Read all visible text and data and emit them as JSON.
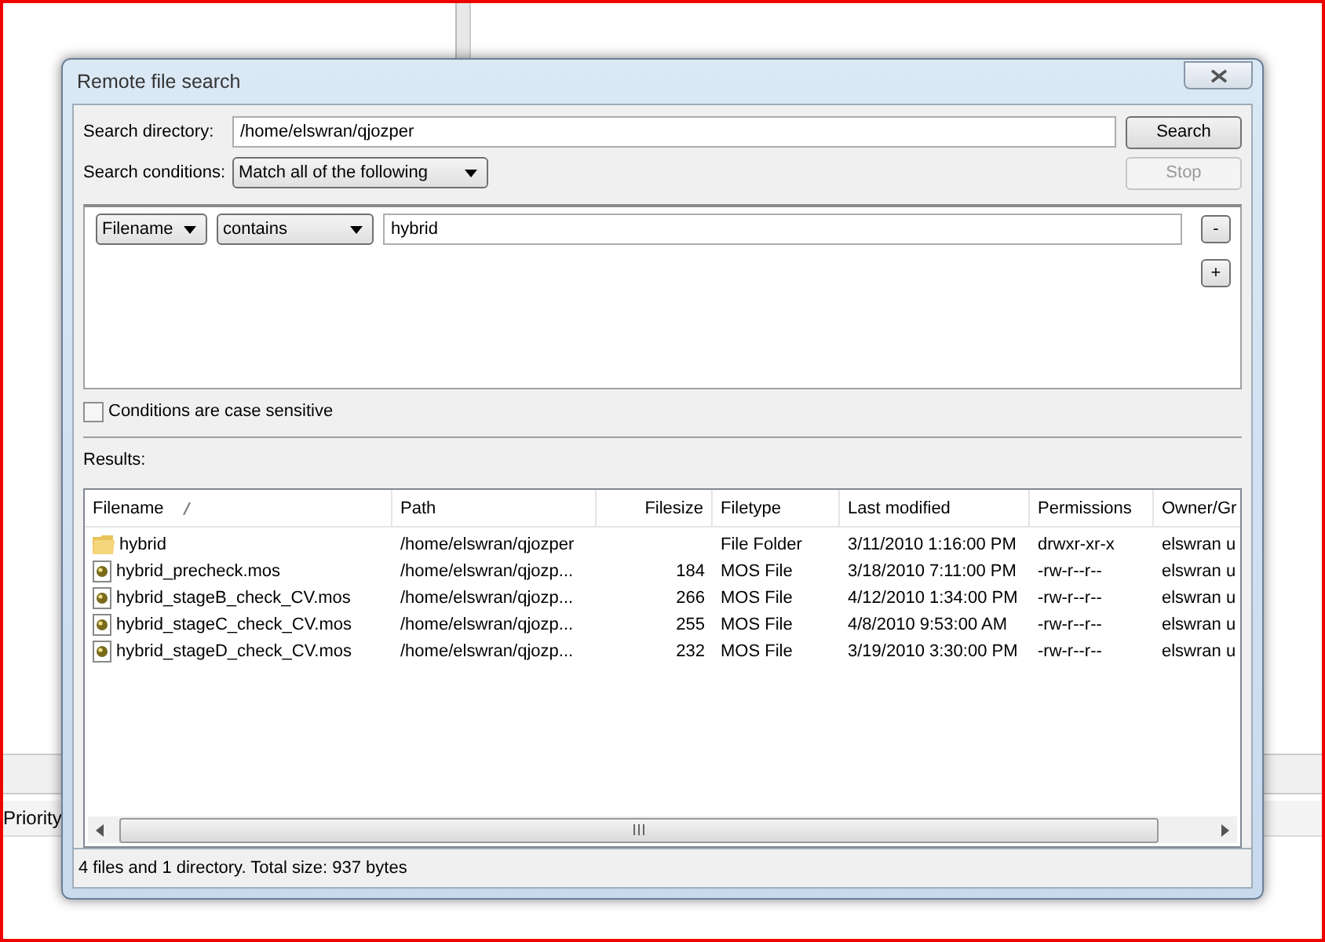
{
  "background": {
    "column_label": "Priority"
  },
  "window": {
    "title": "Remote file search"
  },
  "search_directory": {
    "label": "Search directory:",
    "value": "/home/elswran/qjozper"
  },
  "search_button": {
    "label": "Search",
    "disabled": false
  },
  "search_conditions": {
    "label": "Search conditions:",
    "value": "Match all of the following"
  },
  "stop_button": {
    "label": "Stop",
    "disabled": true
  },
  "conditions": [
    {
      "field": "Filename",
      "operator": "contains",
      "value": "hybrid",
      "remove_label": "-"
    }
  ],
  "add_button": {
    "label": "+"
  },
  "case_sensitive": {
    "label": "Conditions are case sensitive",
    "checked": false
  },
  "results": {
    "label": "Results:",
    "columns": [
      {
        "label": "Filename",
        "sorted": true
      },
      {
        "label": "Path",
        "sorted": false
      },
      {
        "label": "Filesize",
        "sorted": false
      },
      {
        "label": "Filetype",
        "sorted": false
      },
      {
        "label": "Last modified",
        "sorted": false
      },
      {
        "label": "Permissions",
        "sorted": false
      },
      {
        "label": "Owner/Gr",
        "sorted": false
      }
    ],
    "rows": [
      {
        "kind": "folder",
        "cells": [
          "hybrid",
          "/home/elswran/qjozper",
          "",
          "File Folder",
          "3/11/2010 1:16:00 PM",
          "drwxr-xr-x",
          "elswran u"
        ]
      },
      {
        "kind": "file",
        "cells": [
          "hybrid_precheck.mos",
          "/home/elswran/qjozp...",
          "184",
          "MOS File",
          "3/18/2010 7:11:00 PM",
          "-rw-r--r--",
          "elswran u"
        ]
      },
      {
        "kind": "file",
        "cells": [
          "hybrid_stageB_check_CV.mos",
          "/home/elswran/qjozp...",
          "266",
          "MOS File",
          "4/12/2010 1:34:00 PM",
          "-rw-r--r--",
          "elswran u"
        ]
      },
      {
        "kind": "file",
        "cells": [
          "hybrid_stageC_check_CV.mos",
          "/home/elswran/qjozp...",
          "255",
          "MOS File",
          "4/8/2010 9:53:00 AM",
          "-rw-r--r--",
          "elswran u"
        ]
      },
      {
        "kind": "file",
        "cells": [
          "hybrid_stageD_check_CV.mos",
          "/home/elswran/qjozp...",
          "232",
          "MOS File",
          "3/19/2010 3:30:00 PM",
          "-rw-r--r--",
          "elswran u"
        ]
      }
    ]
  },
  "status_bar": {
    "text": "4 files and 1 directory. Total size: 937 bytes"
  }
}
